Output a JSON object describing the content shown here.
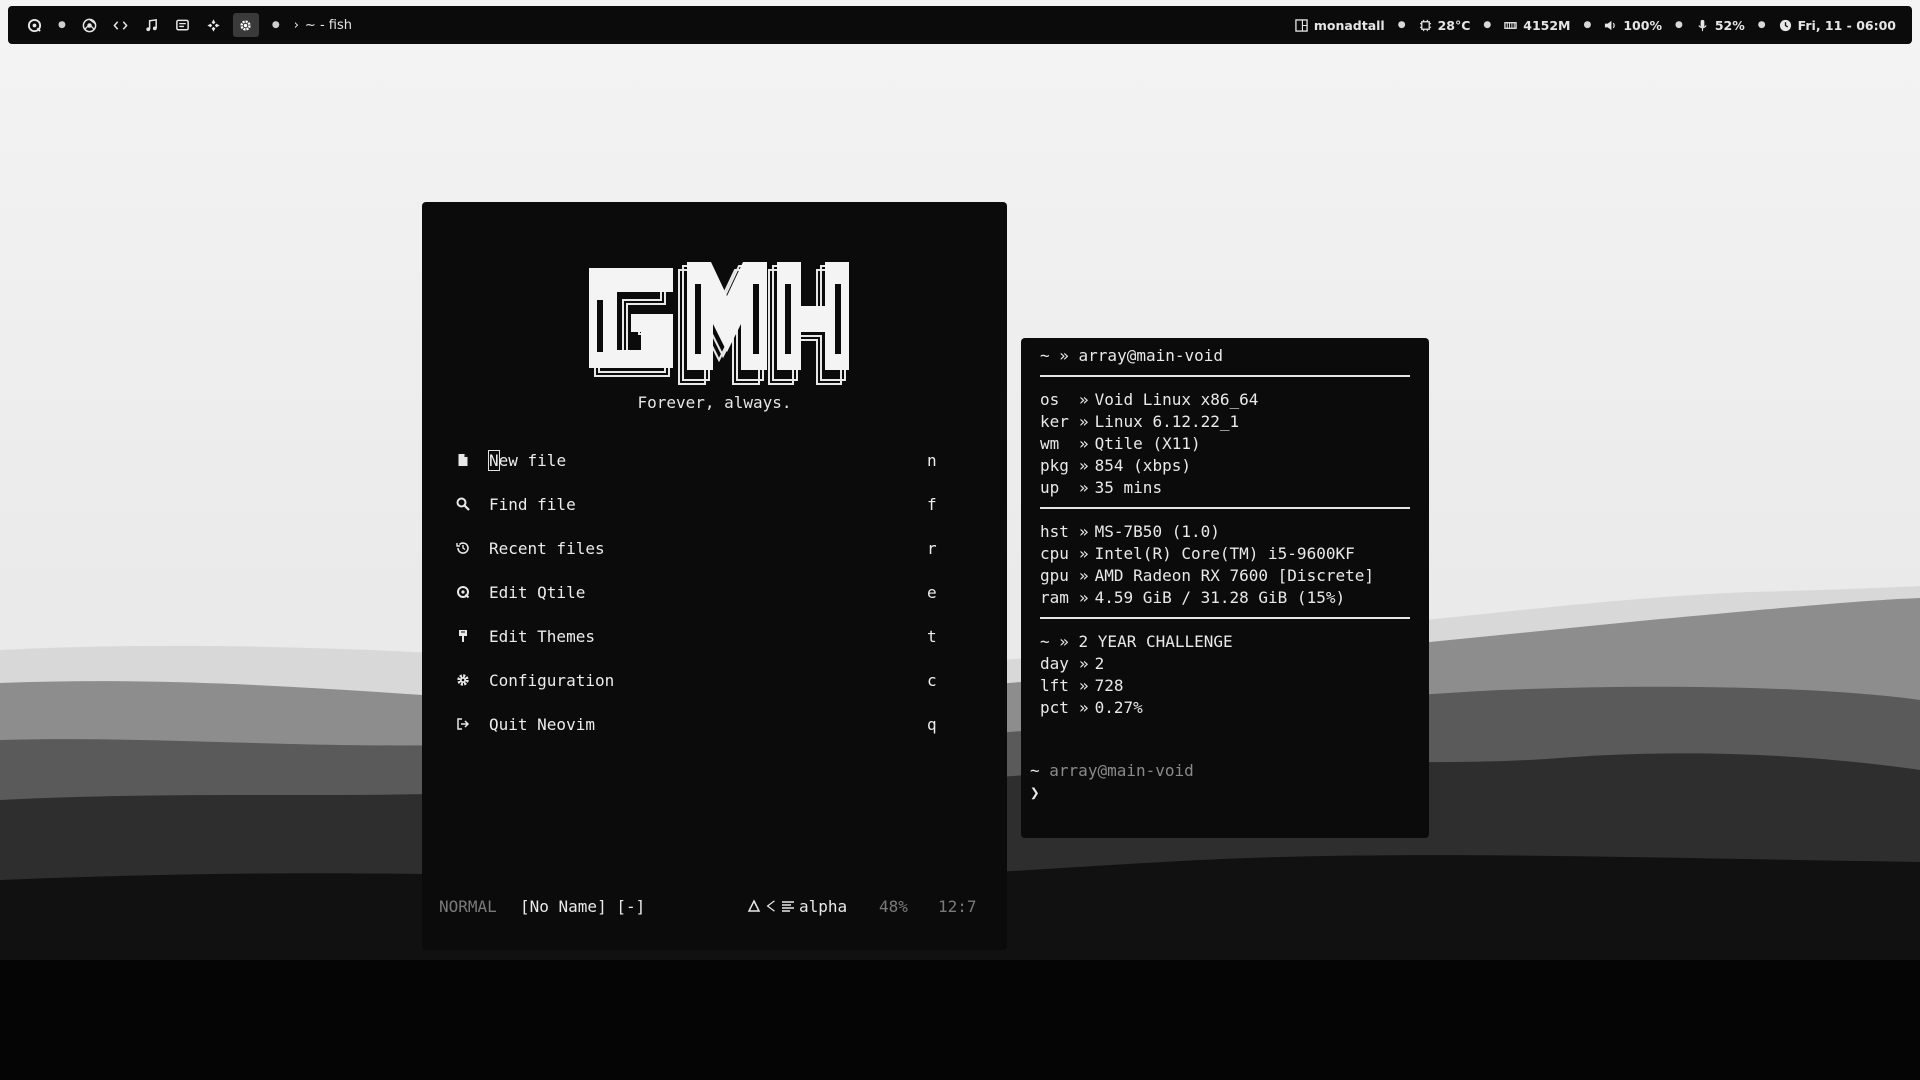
{
  "topbar": {
    "workspace_icons": [
      "qtile-logo-icon",
      "browser-icon",
      "code-icon",
      "music-icon",
      "chat-icon",
      "games-icon",
      "settings-icon"
    ],
    "active_window_title": "~ - fish",
    "layout": "monadtall",
    "temperature": "28°C",
    "memory": "4152M",
    "volume": "100%",
    "mic": "52%",
    "datetime": "Fri, 11 - 06:00"
  },
  "nvim": {
    "tagline": "Forever, always.",
    "menu": [
      {
        "label": "New file",
        "key": "n",
        "icon": "file-icon"
      },
      {
        "label": "Find file",
        "key": "f",
        "icon": "search-icon"
      },
      {
        "label": "Recent files",
        "key": "r",
        "icon": "history-icon"
      },
      {
        "label": "Edit Qtile",
        "key": "e",
        "icon": "qtile-icon"
      },
      {
        "label": "Edit Themes",
        "key": "t",
        "icon": "brush-icon"
      },
      {
        "label": "Configuration",
        "key": "c",
        "icon": "gear-icon"
      },
      {
        "label": "Quit Neovim",
        "key": "q",
        "icon": "exit-icon"
      }
    ],
    "statusline": {
      "mode": "NORMAL",
      "file": "[No Name] [-]",
      "filetype": "alpha",
      "percent": "48%",
      "position": "12:7"
    }
  },
  "terminal": {
    "header": "~ » array@main-void",
    "sys": [
      {
        "key": "os",
        "value": "Void Linux x86_64"
      },
      {
        "key": "ker",
        "value": "Linux 6.12.22_1"
      },
      {
        "key": "wm",
        "value": "Qtile (X11)"
      },
      {
        "key": "pkg",
        "value": "854 (xbps)"
      },
      {
        "key": "up",
        "value": "35 mins"
      }
    ],
    "hw": [
      {
        "key": "hst",
        "value": "MS-7B50 (1.0)"
      },
      {
        "key": "cpu",
        "value": "Intel(R) Core(TM) i5-9600KF"
      },
      {
        "key": "gpu",
        "value": "AMD Radeon RX 7600 [Discrete]"
      },
      {
        "key": "ram",
        "value": "4.59 GiB / 31.28 GiB (15%)"
      }
    ],
    "challenge_header": "~ » 2 YEAR CHALLENGE",
    "challenge": [
      {
        "key": "day",
        "value": "2"
      },
      {
        "key": "lft",
        "value": "728"
      },
      {
        "key": "pct",
        "value": "0.27%"
      }
    ],
    "prompt_path": "~",
    "prompt_host": "array@main-void",
    "prompt_symbol": "❯"
  }
}
